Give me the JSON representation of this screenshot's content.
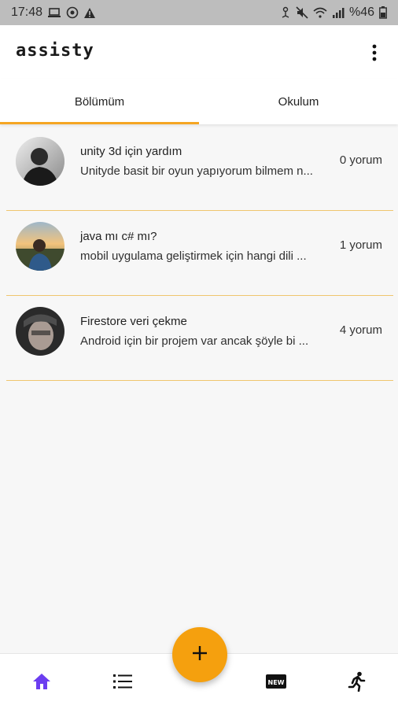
{
  "status_bar": {
    "time": "17:48",
    "battery": "%46"
  },
  "app": {
    "title": "assisty"
  },
  "tabs": [
    {
      "label": "Bölümüm",
      "active": true
    },
    {
      "label": "Okulum",
      "active": false
    }
  ],
  "questions": [
    {
      "title": "unity 3d için yardım",
      "preview": "Unityde basit bir oyun yapıyorum bilmem n...",
      "comments": "0 yorum"
    },
    {
      "title": "java mı c# mı?",
      "preview": "mobil uygulama geliştirmek için hangi dili ...",
      "comments": "1 yorum"
    },
    {
      "title": "Firestore veri çekme",
      "preview": "Android için bir projem var ancak şöyle bi ...",
      "comments": "4 yorum"
    }
  ],
  "bottom_nav": {
    "items": [
      {
        "icon": "home-icon",
        "active": true
      },
      {
        "icon": "list-icon",
        "active": false
      },
      {
        "icon": "new-badge-icon",
        "active": false
      },
      {
        "icon": "run-icon",
        "active": false
      }
    ],
    "fab_icon": "plus-icon"
  },
  "colors": {
    "accent": "#f5a623",
    "fab": "#f5a00e",
    "active_nav": "#6b3df0",
    "divider": "#f0c66f"
  }
}
